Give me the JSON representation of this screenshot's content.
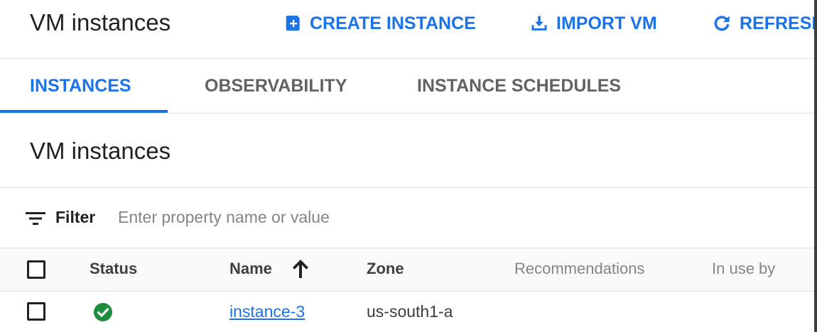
{
  "header": {
    "title": "VM instances",
    "actions": [
      {
        "label": "CREATE INSTANCE",
        "icon": "add-box-icon"
      },
      {
        "label": "IMPORT VM",
        "icon": "download-icon"
      },
      {
        "label": "REFRESH",
        "icon": "refresh-icon"
      }
    ]
  },
  "tabs": [
    {
      "label": "INSTANCES",
      "active": true
    },
    {
      "label": "OBSERVABILITY",
      "active": false
    },
    {
      "label": "INSTANCE SCHEDULES",
      "active": false
    }
  ],
  "section": {
    "title": "VM instances"
  },
  "filter": {
    "label": "Filter",
    "placeholder": "Enter property name or value",
    "value": ""
  },
  "table": {
    "columns": [
      "Status",
      "Name",
      "Zone",
      "Recommendations",
      "In use by"
    ],
    "sort": {
      "column": "Name",
      "direction": "ascending"
    },
    "rows": [
      {
        "status": "running",
        "name": "instance-3",
        "zone": "us-south1-a",
        "recommendations": "",
        "in_use_by": ""
      }
    ]
  },
  "colors": {
    "accent": "#1a73e8",
    "status_ok": "#1e8e3e",
    "text": "#202124",
    "muted": "#80868b"
  }
}
